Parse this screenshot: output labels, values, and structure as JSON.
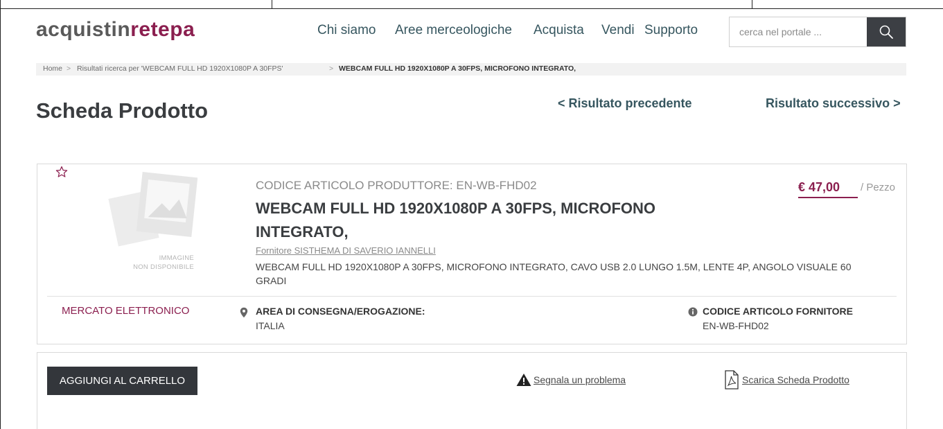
{
  "header": {
    "logo_part1": "acquistin",
    "logo_part2": "rete",
    "logo_part3": "pa",
    "nav": [
      "Chi siamo",
      "Aree merceologiche",
      "Acquista",
      "Vendi",
      "Supporto"
    ],
    "search_placeholder": "cerca nel portale ...",
    "search_icon": "search-icon"
  },
  "breadcrumb": {
    "home": "Home",
    "separator": ">",
    "results": "Risultati ricerca per 'WEBCAM FULL HD 1920X1080P A 30FPS'",
    "current": "WEBCAM FULL HD 1920X1080P A 30FPS, MICROFONO INTEGRATO,"
  },
  "page": {
    "title": "Scheda Prodotto",
    "prev": "< Risultato precedente",
    "next": "Risultato successivo >"
  },
  "product": {
    "image_placeholder_line1": "IMMAGINE",
    "image_placeholder_line2": "NON DISPONIBILE",
    "manufacturer_code": "CODICE ARTICOLO PRODUTTORE: EN-WB-FHD02",
    "name": "WEBCAM FULL HD 1920X1080P A 30FPS, MICROFONO INTEGRATO,",
    "supplier": "Fornitore SISTHEMA DI SAVERIO IANNELLI",
    "description": "WEBCAM FULL HD 1920X1080P A 30FPS, MICROFONO INTEGRATO, CAVO USB 2.0 LUNGO 1.5M, LENTE 4P, ANGOLO VISUALE 60 GRADI",
    "price": "€ 47,00",
    "unit": "/ Pezzo",
    "market": "MERCATO ELETTRONICO",
    "delivery_area_label": "AREA DI CONSEGNA/EROGAZIONE:",
    "delivery_area_value": "ITALIA",
    "supplier_code_label": "CODICE ARTICOLO FORNITORE",
    "supplier_code_value": "EN-WB-FHD02"
  },
  "actions": {
    "add_to_cart": "AGGIUNGI AL CARRELLO",
    "report_problem": "Segnala un problema",
    "download_sheet": "Scarica Scheda Prodotto"
  },
  "colors": {
    "brand": "#8b1f4f",
    "nav_text": "#36565f",
    "button_dark": "#33363b"
  }
}
